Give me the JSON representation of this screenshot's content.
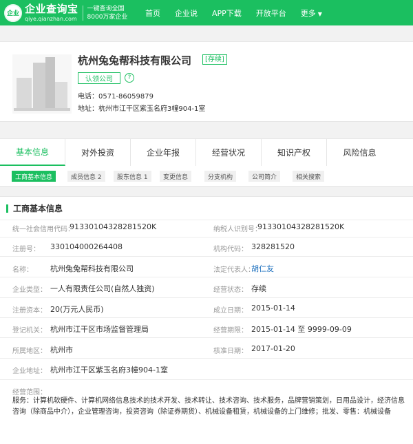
{
  "header": {
    "logo_badge": "企业",
    "logo_name": "企业查询宝",
    "logo_domain": "qiye.qianzhan.com",
    "slogan_line1": "一键查询全国",
    "slogan_line2": "8000万家企业",
    "nav": [
      {
        "label": "首页"
      },
      {
        "label": "企业说"
      },
      {
        "label": "APP下载"
      },
      {
        "label": "开放平台"
      },
      {
        "label": "更多"
      }
    ]
  },
  "company": {
    "name": "杭州兔兔帮科技有限公司",
    "status_tag": "[存续]",
    "claim_label": "认领公司",
    "help_icon": "?",
    "phone_label": "电话：",
    "phone": "0571-86059879",
    "address_label": "地址：",
    "address": "杭州市江干区紫玉名府3幢904-1室"
  },
  "tabs": [
    {
      "label": "基本信息",
      "active": true
    },
    {
      "label": "对外投资"
    },
    {
      "label": "企业年报"
    },
    {
      "label": "经营状况"
    },
    {
      "label": "知识产权"
    },
    {
      "label": "风险信息"
    }
  ],
  "subtabs": [
    {
      "label": "工商基本信息",
      "active": true
    },
    {
      "label": "成员信息 2"
    },
    {
      "label": "股东信息 1"
    },
    {
      "label": "变更信息"
    },
    {
      "label": "分支机构"
    },
    {
      "label": "公司简介"
    },
    {
      "label": "相关搜索"
    }
  ],
  "info": {
    "title": "工商基本信息",
    "fields": {
      "credit_code_label": "统一社会信用代码：",
      "credit_code": "91330104328281520K",
      "taxpayer_id_label": "纳税人识别号：",
      "taxpayer_id": "91330104328281520K",
      "reg_no_label": "注册号：",
      "reg_no": "330104000264408",
      "org_code_label": "机构代码：",
      "org_code": "328281520",
      "name_label": "名称：",
      "name": "杭州兔兔帮科技有限公司",
      "legal_rep_label": "法定代表人：",
      "legal_rep": "胡仁友",
      "type_label": "企业类型：",
      "type": "一人有限责任公司(自然人独资)",
      "status_label": "经营状态：",
      "status": "存续",
      "capital_label": "注册资本：",
      "capital": "20(万元人民币)",
      "founded_label": "成立日期：",
      "founded": "2015-01-14",
      "authority_label": "登记机关：",
      "authority": "杭州市江干区市场监督管理局",
      "term_label": "经营期限：",
      "term": "2015-01-14 至 9999-09-09",
      "region_label": "所属地区：",
      "region": "杭州市",
      "approval_label": "核准日期：",
      "approval": "2017-01-20",
      "address_label": "企业地址：",
      "address": "杭州市江干区紫玉名府3幢904-1室"
    },
    "scope_label": "经营范围：",
    "scope": "服务：计算机软硬件、计算机网络信息技术的技术开发、技术转让、技术咨询、技术服务，品牌营销策划，日用品设计，经济信息咨询（除商品中介），企业管理咨询，投资咨询（除证券期货）、机械设备租赁，机械设备的上门维修；批发、零售：机械设备"
  },
  "colors": {
    "accent": "#1bbf60",
    "link": "#1a6ebd"
  }
}
